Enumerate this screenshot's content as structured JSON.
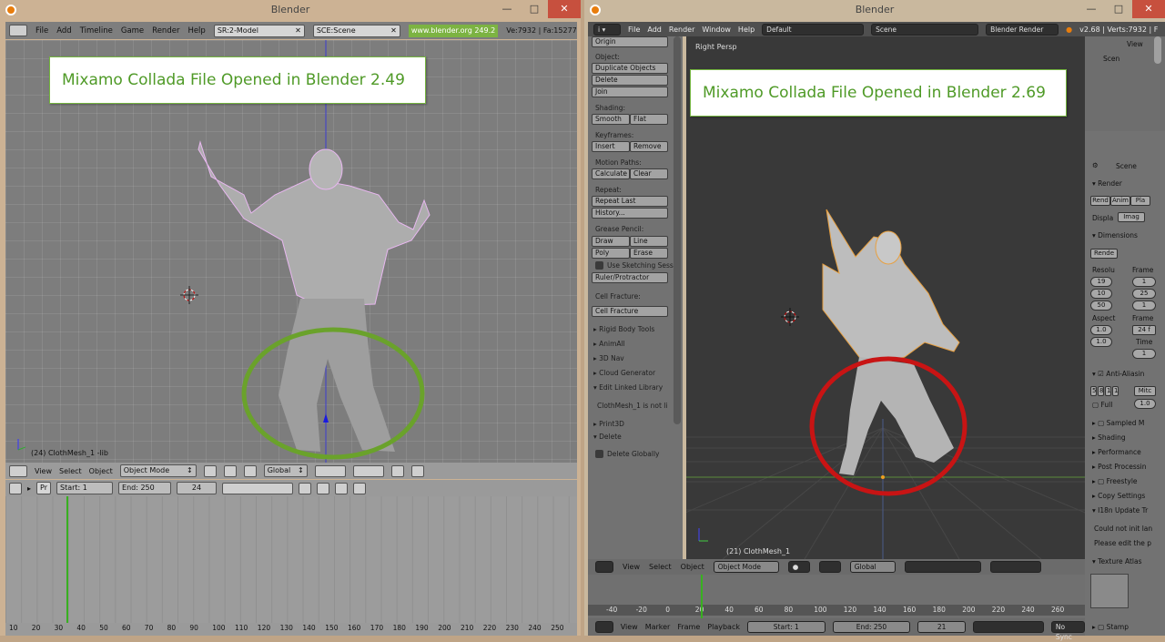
{
  "left_window": {
    "title": "Blender",
    "menu": [
      "File",
      "Add",
      "Timeline",
      "Game",
      "Render",
      "Help"
    ],
    "screen_field": "SR:2-Model",
    "scene_field": "SCE:Scene",
    "url": "www.blender.org 249.2",
    "stats": "Ve:7932 | Fa:15277",
    "caption": "Mixamo Collada File Opened in Blender 2.49",
    "object_info": "(24) ClothMesh_1 -lib",
    "header_menu": [
      "View",
      "Select",
      "Object"
    ],
    "mode": "Object Mode",
    "orientation": "Global",
    "timeline": {
      "pr": "Pr",
      "start": "Start: 1",
      "end": "End: 250",
      "frame": "24"
    },
    "ruler": [
      "10",
      "20",
      "30",
      "40",
      "50",
      "60",
      "70",
      "80",
      "90",
      "100",
      "110",
      "120",
      "130",
      "140",
      "150",
      "160",
      "170",
      "180",
      "190",
      "200",
      "210",
      "220",
      "230",
      "240",
      "250"
    ]
  },
  "right_window": {
    "title": "Blender",
    "menu": [
      "File",
      "Add",
      "Render",
      "Window",
      "Help"
    ],
    "layout": "Default",
    "scene": "Scene",
    "engine": "Blender Render",
    "stats": "v2.68 | Verts:7932 | F",
    "viewport_label": "Right Persp",
    "caption": "Mixamo Collada File Opened in Blender 2.69",
    "object_info": "(21) ClothMesh_1",
    "tools": {
      "origin": "Origin",
      "object_label": "Object:",
      "duplicate": "Duplicate Objects",
      "delete": "Delete",
      "join": "Join",
      "shading_label": "Shading:",
      "smooth": "Smooth",
      "flat": "Flat",
      "keyframes_label": "Keyframes:",
      "insert": "Insert",
      "remove": "Remove",
      "motion_label": "Motion Paths:",
      "calculate": "Calculate",
      "clear": "Clear",
      "repeat_label": "Repeat:",
      "repeat_last": "Repeat Last",
      "history": "History...",
      "grease_label": "Grease Pencil:",
      "draw": "Draw",
      "line": "Line",
      "poly": "Poly",
      "erase": "Erase",
      "sketching": "Use Sketching Sessi",
      "ruler": "Ruler/Protractor",
      "cell_label": "Cell Fracture:",
      "cell_btn": "Cell Fracture",
      "rigid": "Rigid Body Tools",
      "animall": "AnimAll",
      "nav3d": "3D Nav",
      "cloud": "Cloud Generator",
      "edit_linked": "Edit Linked Library",
      "linked_msg": "ClothMesh_1 is not li",
      "print3d": "Print3D",
      "delete_panel": "Delete",
      "delete_globally": "Delete Globally"
    },
    "header_menu": [
      "View",
      "Select",
      "Object"
    ],
    "mode": "Object Mode",
    "orientation": "Global",
    "timeline_ruler": [
      "-40",
      "-20",
      "0",
      "20",
      "40",
      "60",
      "80",
      "100",
      "120",
      "140",
      "160",
      "180",
      "200",
      "220",
      "240",
      "260"
    ],
    "bottom_menu": [
      "View",
      "Marker",
      "Frame",
      "Playback"
    ],
    "start": "Start: 1",
    "end": "End: 250",
    "frame": "21",
    "sync": "No Sync",
    "outliner": {
      "view": "View",
      "scene": "Scen"
    },
    "properties": {
      "scene": "Scene",
      "render": "Render",
      "rend_btn": "Rend",
      "anim_btn": "Anim",
      "play_btn": "Pla",
      "display": "Displa",
      "image": "Imag",
      "dimensions": "Dimensions",
      "render_preset": "Rende",
      "resolution": "Resolu",
      "frame": "Frame",
      "res_x": "19",
      "res_y": "10",
      "res_pct": "50",
      "fstart": "1",
      "fend": "25",
      "fstep": "1",
      "aspect": "Aspect",
      "frame_rate": "Frame",
      "asp_x": "1.0",
      "asp_y": "1.0",
      "fps": "24 f",
      "time": "Time",
      "time_val": "1",
      "anti_alias": "Anti-Aliasin",
      "aa_samples": [
        "5",
        "8",
        "1",
        "1"
      ],
      "filter": "Mitc",
      "full": "Full",
      "full_val": "1.0",
      "sampled": "Sampled M",
      "shading": "Shading",
      "performance": "Performance",
      "post": "Post Processin",
      "freestyle": "Freestyle",
      "copy": "Copy Settings",
      "i18n": "I18n Update Tr",
      "err1": "Could not init lan",
      "err2": "Please edit the p",
      "texture_atlas": "Texture Atlas",
      "stamp": "Stamp"
    }
  }
}
